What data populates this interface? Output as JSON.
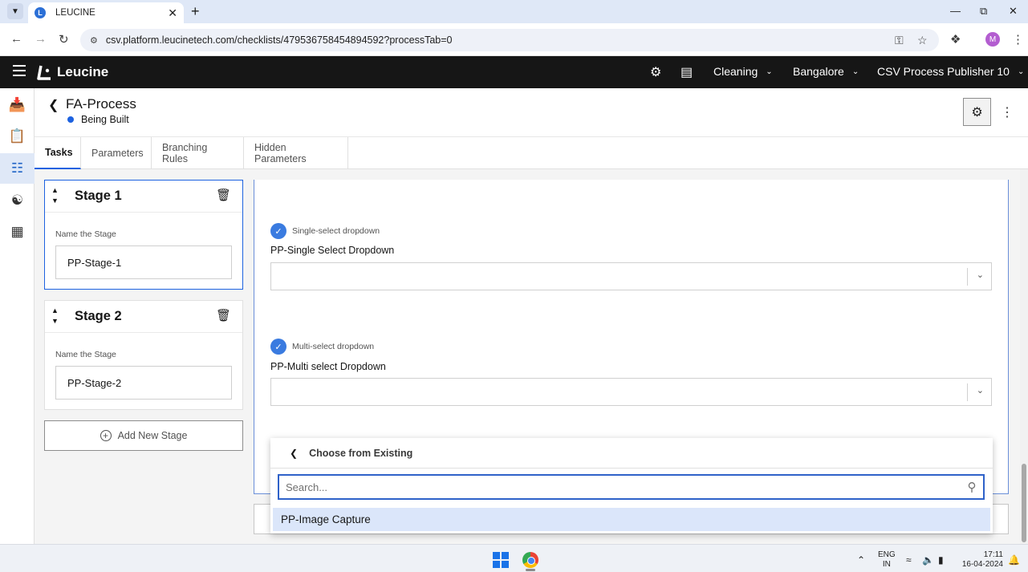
{
  "browser": {
    "tab_title": "LEUCINE",
    "tab_favicon_letter": "L",
    "url": "csv.platform.leucinetech.com/checklists/479536758454894592?processTab=0",
    "profile_initial": "M"
  },
  "app": {
    "logo_text": "Leucine",
    "header": {
      "facility_label": "Cleaning",
      "site_label": "Bangalore",
      "user_label": "CSV Process Publisher 10"
    }
  },
  "process": {
    "title": "FA-Process",
    "status": "Being Built",
    "status_color": "#1d62e0"
  },
  "tabs": [
    {
      "label": "Tasks",
      "active": true
    },
    {
      "label": "Parameters",
      "active": false
    },
    {
      "label": "Branching Rules",
      "active": false
    },
    {
      "label": "Hidden Parameters",
      "active": false
    }
  ],
  "stages": [
    {
      "name": "Stage 1",
      "field_label": "Name the Stage",
      "value": "PP-Stage-1"
    },
    {
      "name": "Stage 2",
      "field_label": "Name the Stage",
      "value": "PP-Stage-2"
    }
  ],
  "add_stage_label": "Add New Stage",
  "parameters": [
    {
      "type": "Single-select dropdown",
      "name": "PP-Single Select Dropdown"
    },
    {
      "type": "Multi-select dropdown",
      "name": "PP-Multi select Dropdown"
    }
  ],
  "popup": {
    "title": "Choose from Existing",
    "search_placeholder": "Search...",
    "options": [
      "PP-Image Capture"
    ]
  },
  "taskbar": {
    "lang_top": "ENG",
    "lang_bottom": "IN",
    "time": "17:11",
    "date": "16-04-2024"
  }
}
